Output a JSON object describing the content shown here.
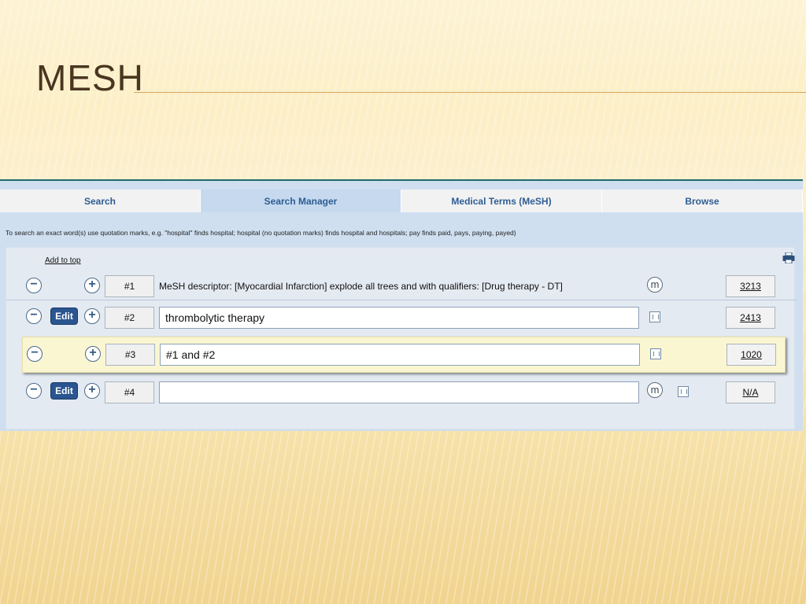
{
  "slide": {
    "title": "MESH"
  },
  "tabs": [
    {
      "label": "Search",
      "active": false
    },
    {
      "label": "Search Manager",
      "active": true
    },
    {
      "label": "Medical Terms (MeSH)",
      "active": false
    },
    {
      "label": "Browse",
      "active": false
    }
  ],
  "hint": "To search an exact word(s) use quotation marks, e.g. \"hospital\" finds hospital; hospital (no quotation marks) finds hospital and hospitals; pay finds paid, pays, paying, payed)",
  "workspace": {
    "add_to_top": "Add to top",
    "edit_label": "Edit",
    "minus_glyph": "−",
    "plus_glyph": "+",
    "m_glyph": "m",
    "rows": [
      {
        "number": "#1",
        "text": "MeSH descriptor: [Myocardial Infarction] explode all trees and with qualifiers: [Drug therapy - DT]",
        "count": "3213",
        "editable": false
      },
      {
        "number": "#2",
        "text": "thrombolytic therapy",
        "count": "2413",
        "editable": true
      },
      {
        "number": "#3",
        "text": "#1 and #2",
        "count": "1020",
        "editable": false,
        "highlighted": true
      },
      {
        "number": "#4",
        "text": "",
        "count": "N/A",
        "editable": true
      }
    ]
  },
  "colors": {
    "title": "#4a3520",
    "accent_rule": "#d9a35a",
    "tab_text": "#2d5d93",
    "edit_button": "#2a5590"
  },
  "icons": [
    "minus-circle-icon",
    "plus-circle-icon",
    "mesh-m-icon",
    "qualifier-grid-icon",
    "print-icon"
  ]
}
